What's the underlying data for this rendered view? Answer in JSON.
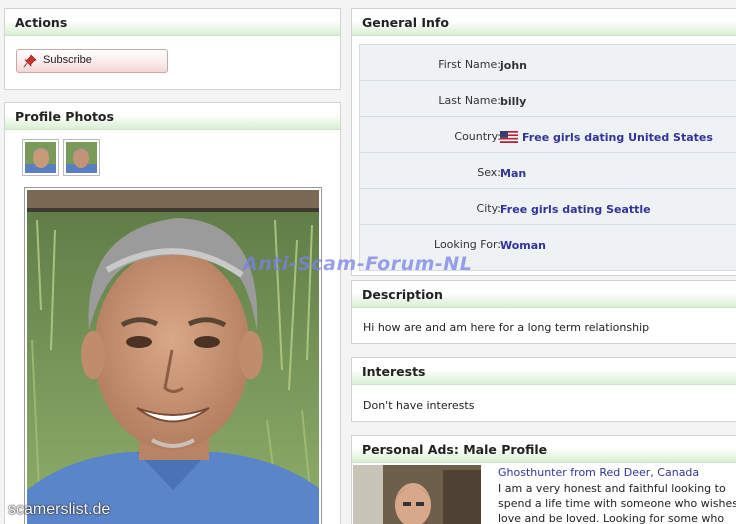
{
  "actions": {
    "title": "Actions",
    "subscribe_label": "Subscribe"
  },
  "photos": {
    "title": "Profile Photos"
  },
  "general": {
    "title": "General Info",
    "rows": [
      {
        "label": "First Name:",
        "value": "john"
      },
      {
        "label": "Last Name:",
        "value": "billy"
      },
      {
        "label": "Country:",
        "value": "Free girls dating United States"
      },
      {
        "label": "Sex:",
        "value": "Man"
      },
      {
        "label": "City:",
        "value": "Free girls dating Seattle"
      },
      {
        "label": "Looking For:",
        "value": "Woman"
      }
    ]
  },
  "description": {
    "title": "Description",
    "text": "Hi how are and am here for a long term relationship"
  },
  "interests": {
    "title": "Interests",
    "text": "Don't have interests"
  },
  "ads": {
    "title": "Personal Ads: Male Profile",
    "ad_title": "Ghosthunter from Red Deer, Canada",
    "lines": [
      "I am a very honest and faithful looking to",
      "spend a life time with someone who wishes",
      "love and be loved. Looking for some who"
    ]
  },
  "watermark": "Anti-Scam-Forum-NL",
  "watermark_site": "scamerslist.de",
  "colors": {
    "link": "#333399",
    "header_gradient": "#d8f0d2",
    "info_bg": "#eef2f5"
  }
}
